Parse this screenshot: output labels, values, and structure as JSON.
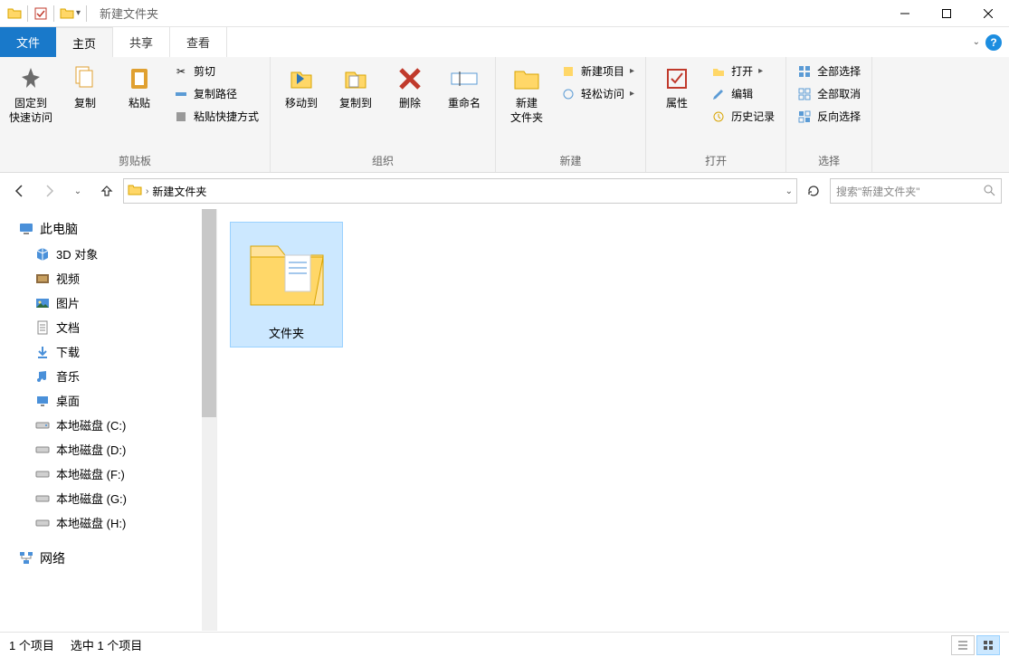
{
  "title": "新建文件夹",
  "tabs": {
    "file": "文件",
    "home": "主页",
    "share": "共享",
    "view": "查看"
  },
  "ribbon": {
    "clipboard": {
      "label": "剪贴板",
      "pin": "固定到\n快速访问",
      "copy": "复制",
      "paste": "粘贴",
      "cut": "剪切",
      "copypath": "复制路径",
      "pasteshortcut": "粘贴快捷方式"
    },
    "organize": {
      "label": "组织",
      "moveto": "移动到",
      "copyto": "复制到",
      "delete": "删除",
      "rename": "重命名"
    },
    "newg": {
      "label": "新建",
      "newfolder": "新建\n文件夹",
      "newitem": "新建项目",
      "easyaccess": "轻松访问"
    },
    "open": {
      "label": "打开",
      "properties": "属性",
      "opentext": "打开",
      "edit": "编辑",
      "history": "历史记录"
    },
    "select": {
      "label": "选择",
      "selectall": "全部选择",
      "selectnone": "全部取消",
      "invert": "反向选择"
    }
  },
  "breadcrumb": {
    "segment": "新建文件夹"
  },
  "search": {
    "placeholder": "搜索\"新建文件夹\""
  },
  "nav": {
    "thispc": "此电脑",
    "items": [
      {
        "label": "3D 对象"
      },
      {
        "label": "视频"
      },
      {
        "label": "图片"
      },
      {
        "label": "文档"
      },
      {
        "label": "下载"
      },
      {
        "label": "音乐"
      },
      {
        "label": "桌面"
      },
      {
        "label": "本地磁盘 (C:)"
      },
      {
        "label": "本地磁盘 (D:)"
      },
      {
        "label": "本地磁盘 (F:)"
      },
      {
        "label": "本地磁盘 (G:)"
      },
      {
        "label": "本地磁盘 (H:)"
      }
    ],
    "network": "网络"
  },
  "content": {
    "folder_name": "文件夹"
  },
  "status": {
    "count": "1 个项目",
    "selected": "选中 1 个项目"
  }
}
